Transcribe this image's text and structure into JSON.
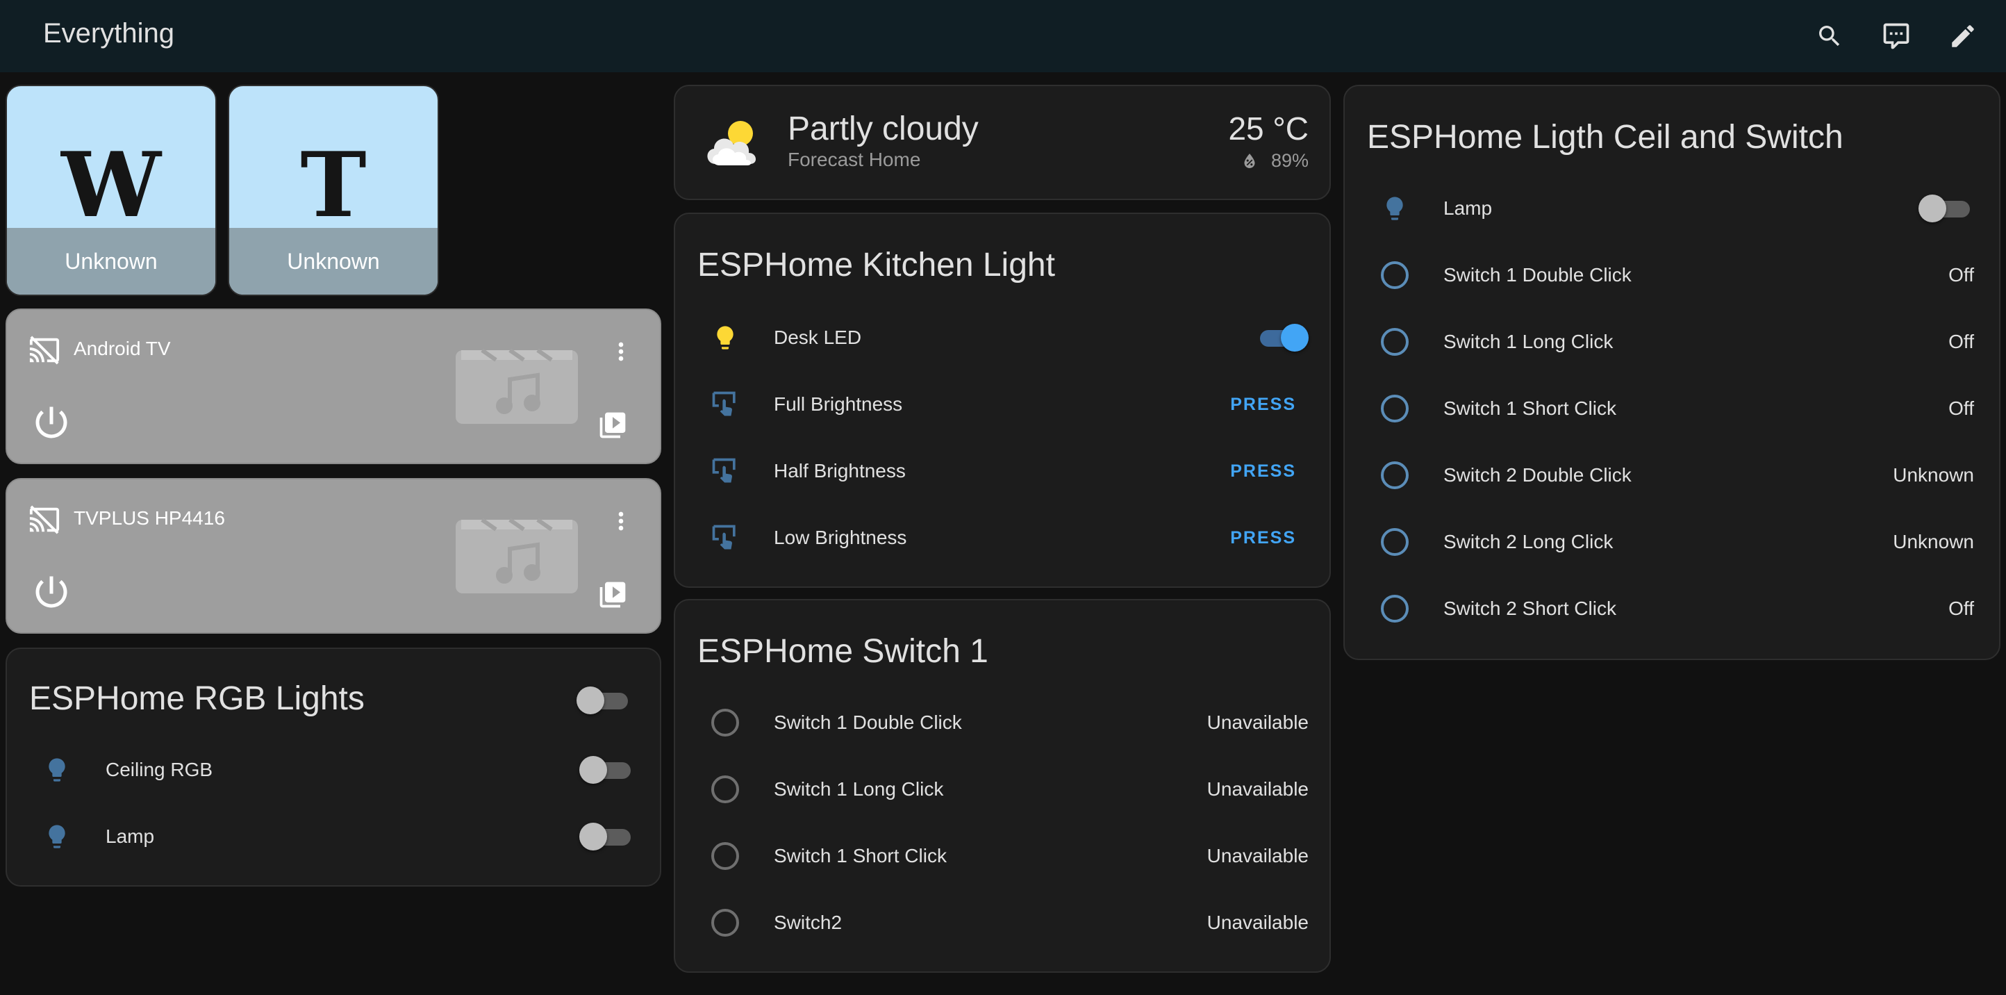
{
  "header": {
    "title": "Everything"
  },
  "pictures": [
    {
      "letter": "W",
      "caption": "Unknown"
    },
    {
      "letter": "T",
      "caption": "Unknown"
    }
  ],
  "media_players": [
    {
      "name": "Android TV"
    },
    {
      "name": "TVPLUS HP4416"
    }
  ],
  "rgb_lights": {
    "title": "ESPHome RGB Lights",
    "items": [
      {
        "label": "Ceiling RGB",
        "icon": "lightbulb-icon"
      },
      {
        "label": "Lamp",
        "icon": "lightbulb-icon"
      }
    ]
  },
  "weather": {
    "condition": "Partly cloudy",
    "location": "Forecast Home",
    "temperature": "25 °C",
    "humidity": "89%"
  },
  "kitchen": {
    "title": "ESPHome Kitchen Light",
    "items": [
      {
        "label": "Desk LED",
        "type": "toggle",
        "state": "on"
      },
      {
        "label": "Full Brightness",
        "action": "PRESS"
      },
      {
        "label": "Half Brightness",
        "action": "PRESS"
      },
      {
        "label": "Low Brightness",
        "action": "PRESS"
      }
    ]
  },
  "switch1": {
    "title": "ESPHome Switch 1",
    "items": [
      {
        "label": "Switch 1 Double Click",
        "value": "Unavailable"
      },
      {
        "label": "Switch 1 Long Click",
        "value": "Unavailable"
      },
      {
        "label": "Switch 1 Short Click",
        "value": "Unavailable"
      },
      {
        "label": "Switch2",
        "value": "Unavailable"
      }
    ]
  },
  "ceil": {
    "title": "ESPHome Ligth Ceil and Switch",
    "items": [
      {
        "label": "Lamp",
        "type": "toggle",
        "state": "off"
      },
      {
        "label": "Switch 1 Double Click",
        "value": "Off"
      },
      {
        "label": "Switch 1 Long Click",
        "value": "Off"
      },
      {
        "label": "Switch 1 Short Click",
        "value": "Off"
      },
      {
        "label": "Switch 2 Double Click",
        "value": "Unknown"
      },
      {
        "label": "Switch 2 Long Click",
        "value": "Unknown"
      },
      {
        "label": "Switch 2 Short Click",
        "value": "Off"
      }
    ]
  },
  "colors": {
    "accent": "#42a5f5",
    "bulb_on": "#fdd835",
    "bulb_off": "#44739e"
  }
}
